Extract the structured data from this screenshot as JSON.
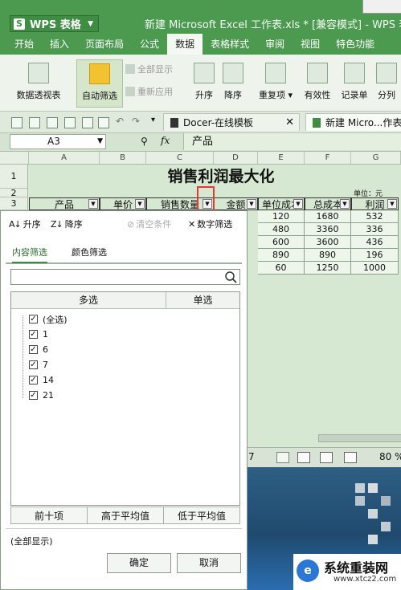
{
  "app": {
    "name": "WPS 表格",
    "logo_glyph": "S",
    "doc_title": "新建 Microsoft Excel 工作表.xls * [兼容模式] - WPS 表格"
  },
  "menu": [
    "开始",
    "插入",
    "页面布局",
    "公式",
    "数据",
    "表格样式",
    "审阅",
    "视图",
    "特色功能"
  ],
  "menu_active": "数据",
  "ribbon": {
    "pivot": "数据透视表",
    "autofilter": "自动筛选",
    "show_all": "全部显示",
    "reapply": "重新应用",
    "asc": "升序",
    "desc": "降序",
    "duplicates": "重复项",
    "duplicates_dd": "▾",
    "validity": "有效性",
    "record": "记录单",
    "split": "分列"
  },
  "tabs": {
    "tab1": "Docer-在线模板",
    "tab2": "新建 Micro...作表"
  },
  "formula": {
    "cell": "A3",
    "value": "产品",
    "fx": "fx",
    "zoom_glyph": "⚲"
  },
  "sheet": {
    "columns": [
      "A",
      "B",
      "C",
      "D",
      "E",
      "F",
      "G"
    ],
    "rows": [
      "1",
      "2",
      "3"
    ],
    "title": "销售利润最大化",
    "unit": "单位：元",
    "headers": [
      "产品",
      "单价",
      "销售数量",
      "金额",
      "单位成本",
      "总成本",
      "利润"
    ],
    "data": [
      [
        "120",
        "1680",
        "532"
      ],
      [
        "480",
        "3360",
        "336"
      ],
      [
        "600",
        "3600",
        "436"
      ],
      [
        "890",
        "890",
        "196"
      ],
      [
        "60",
        "1250",
        "1000"
      ]
    ],
    "status_page": "7",
    "zoom": "80 %"
  },
  "filter": {
    "asc": "升序",
    "desc": "降序",
    "clear": "清空条件",
    "numeric": "数字筛选",
    "tab_content": "内容筛选",
    "tab_color": "颜色筛选",
    "search_placeholder": "",
    "col_multi": "多选",
    "col_single": "单选",
    "items": [
      "(全选)",
      "1",
      "6",
      "7",
      "14",
      "21"
    ],
    "check": "✓",
    "top10": "前十项",
    "above_avg": "高于平均值",
    "below_avg": "低于平均值",
    "show_all": "(全部显示)",
    "ok": "确定",
    "cancel": "取消"
  },
  "watermark": {
    "title": "系统重装网",
    "url": "www.xtcz2.com",
    "logo_char": "e"
  },
  "colors": {
    "titlebar": "#4c9a50",
    "sheet_bg": "#d7e8d2",
    "highlight_box": "#e23b30"
  }
}
